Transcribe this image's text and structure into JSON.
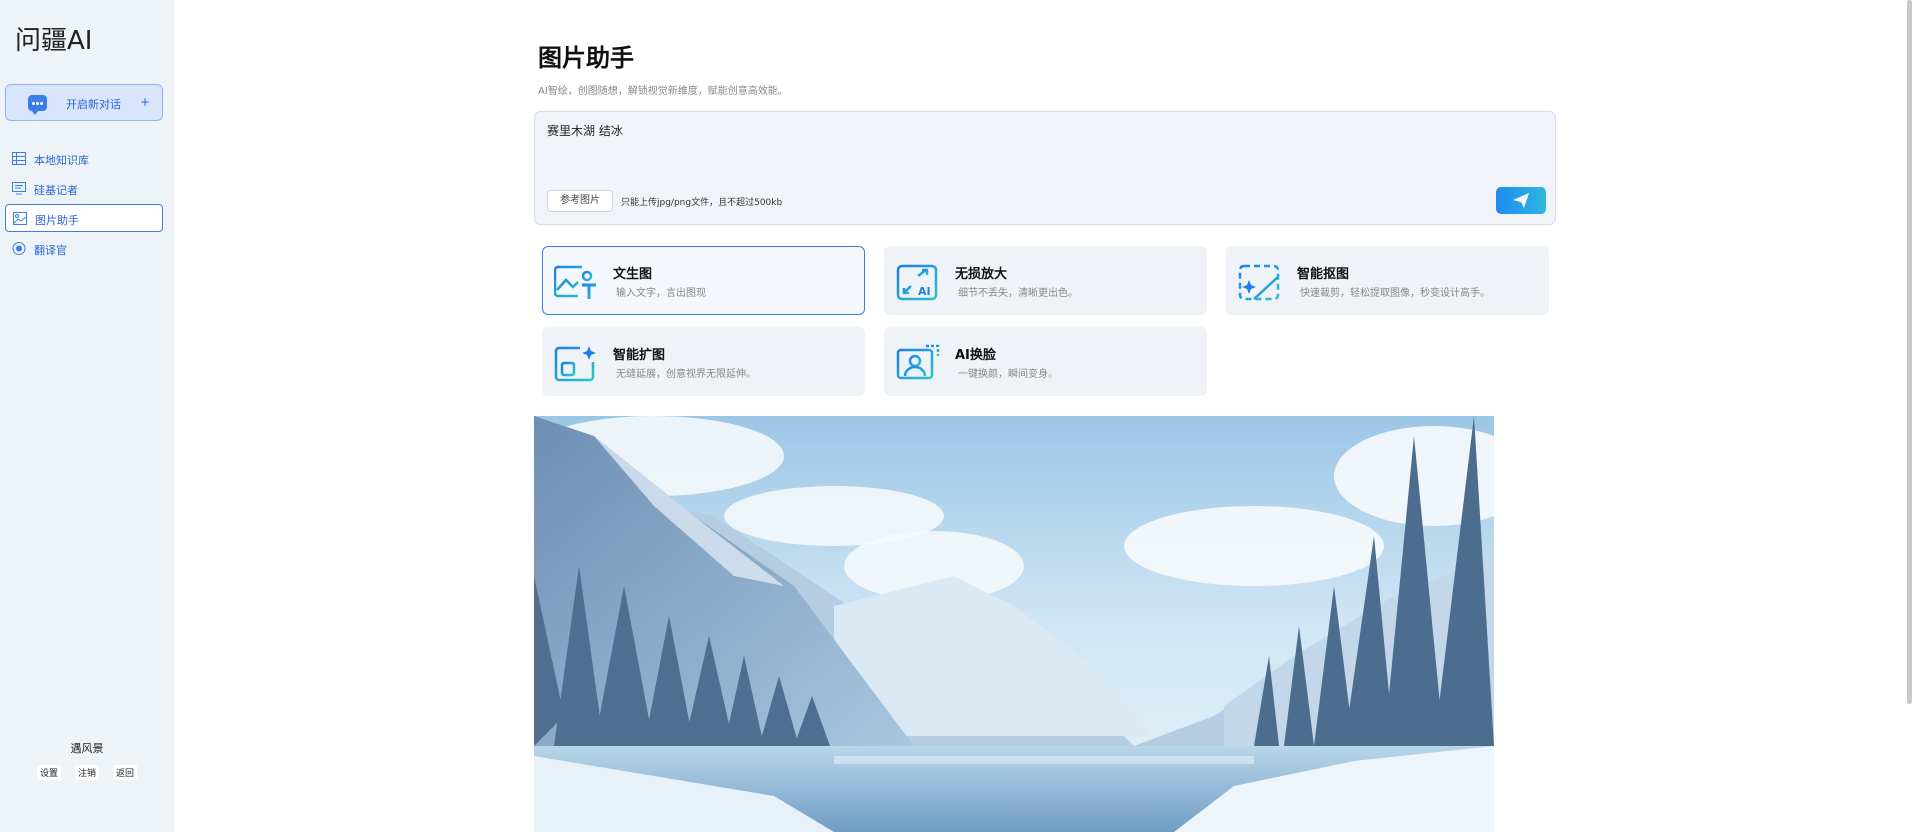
{
  "sidebar": {
    "logo": "问疆AI",
    "new_chat_label": "开启新对话",
    "new_chat_plus": "+",
    "items": [
      {
        "label": "本地知识库"
      },
      {
        "label": "硅基记者"
      },
      {
        "label": "图片助手"
      },
      {
        "label": "翻译官"
      }
    ],
    "user_name": "遇风景",
    "links": [
      "设置",
      "注销",
      "返回"
    ]
  },
  "main": {
    "title": "图片助手",
    "subtitle": "AI智绘，创图随想，解锁视觉新维度，赋能创意高效能。",
    "prompt_value": "赛里木湖 结冰",
    "ref_button": "参考图片",
    "upload_hint": "只能上传jpg/png文件，且不超过500kb",
    "cards": [
      {
        "title": "文生图",
        "desc": "输入文字，言出图现",
        "icon": "text-to-image-icon"
      },
      {
        "title": "无损放大",
        "desc": "细节不丢失，清晰更出色。",
        "icon": "ai-upscale-icon"
      },
      {
        "title": "智能抠图",
        "desc": "快速裁剪，轻松提取图像，秒变设计高手。",
        "icon": "smart-cutout-icon"
      },
      {
        "title": "智能扩图",
        "desc": "无缝延展，创意视界无限延伸。",
        "icon": "smart-expand-icon"
      },
      {
        "title": "AI换脸",
        "desc": "一键换颜，瞬间变身。",
        "icon": "face-swap-icon"
      }
    ]
  },
  "colors": {
    "accent": "#3b7de9",
    "sidebar_bg": "#eef3f8",
    "card_bg": "#eff3f7",
    "send_gradient_start": "#1f8cf0",
    "send_gradient_end": "#2fb6e0"
  }
}
